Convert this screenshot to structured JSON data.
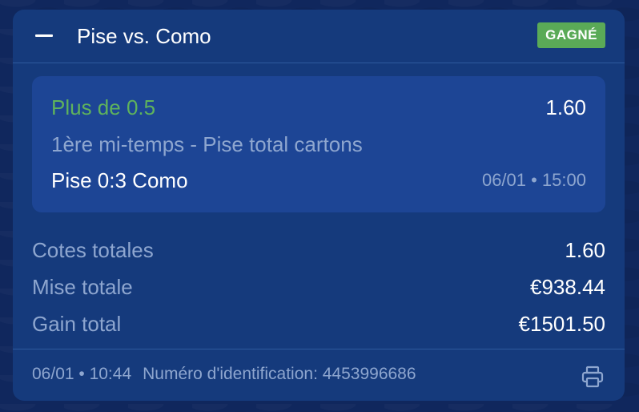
{
  "bet": {
    "title": "Pise vs. Como",
    "status": "GAGNÉ",
    "collapse_icon": "minus-icon"
  },
  "selection": {
    "pick": "Plus de 0.5",
    "odds": "1.60",
    "market": "1ère mi-temps - Pise total cartons",
    "score": "Pise 0:3 Como",
    "datetime": "06/01 • 15:00"
  },
  "summary": {
    "total_odds_label": "Cotes totales",
    "total_odds_value": "1.60",
    "total_stake_label": "Mise totale",
    "total_stake_value": "€938.44",
    "total_win_label": "Gain total",
    "total_win_value": "€1501.50"
  },
  "footer": {
    "datetime": "06/01 • 10:44",
    "id_text": "Numéro d'identification: 4453996686",
    "print_icon": "printer-icon"
  },
  "colors": {
    "background": "#10275d",
    "card": "#153a7c",
    "selection_card": "#1d4595",
    "win_green": "#5aaa57",
    "muted_text": "#8ea6cf"
  }
}
